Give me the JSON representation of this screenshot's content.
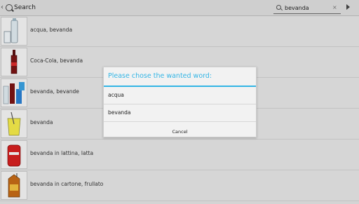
{
  "header": {
    "title": "Search",
    "search_value": "bevanda",
    "clear_glyph": "×"
  },
  "list": {
    "rows": [
      {
        "label": "acqua, bevanda",
        "icon": "water-bottle-glass-icon"
      },
      {
        "label": "Coca-Cola, bevanda",
        "icon": "cola-bottle-icon"
      },
      {
        "label": "bevanda, bevande",
        "icon": "drinks-icon"
      },
      {
        "label": "bevanda",
        "icon": "glass-with-straw-icon"
      },
      {
        "label": "bevanda in lattina, latta",
        "icon": "soda-can-icon"
      },
      {
        "label": "bevanda in cartone, frullato",
        "icon": "juice-carton-icon"
      }
    ]
  },
  "dialog": {
    "title": "Please chose the wanted word:",
    "options": [
      "acqua",
      "bevanda"
    ],
    "cancel_label": "Cancel"
  },
  "colors": {
    "accent": "#33b5e5",
    "background": "#e2e2e2"
  }
}
